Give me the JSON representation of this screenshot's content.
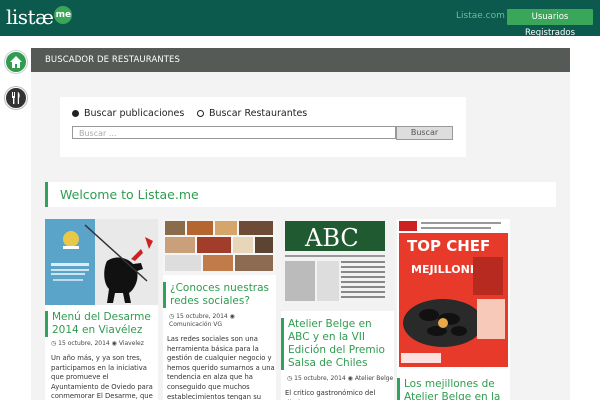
{
  "header": {
    "logo_text": "listæ",
    "logo_badge": "me",
    "link_text": "Listae.com",
    "user_button": "Usuarios Registrados",
    "bg_color": "#0b5a4d",
    "accent_color": "#3aa65a"
  },
  "sidebar": {
    "icons": [
      "home-icon",
      "fork-knife-icon"
    ]
  },
  "section_title": "BUSCADOR DE RESTAURANTES",
  "search": {
    "option1": "Buscar publicaciones",
    "option2": "Buscar Restaurantes",
    "selected": "option1",
    "placeholder": "Buscar ...",
    "button": "Buscar"
  },
  "welcome": "Welcome to Listae.me",
  "posts": [
    {
      "title": "Menú del Desarme 2014 en Viavélez",
      "date": "15 octubre, 2014",
      "author": "Viavelez",
      "excerpt": "Un año más, y ya son tres, participamos en la iniciativa que promueve el Ayuntamiento de Oviedo para conmemorar El Desarme, que tiene su origen en"
    },
    {
      "title": "¿Conoces nuestras redes sociales?",
      "date": "15 octubre, 2014",
      "author": "Comunicación VG",
      "excerpt": "Las redes sociales son una herramienta básica para la gestión de cualquier negocio y hemos querido sumarnos a una tendencia en alza que ha conseguido que muchos establecimientos tengan su"
    },
    {
      "title": "Atelier Belge en ABC y en la VII Edición del Premio Salsa de Chiles",
      "date": "15 octubre, 2014",
      "author": "Atelier Belge",
      "excerpt": "El critico gastronómico del diario"
    },
    {
      "title": "Los mejillones de Atelier Belge en la",
      "image_title": "TOP CHEF",
      "image_sub": "MEJILLONES"
    }
  ]
}
